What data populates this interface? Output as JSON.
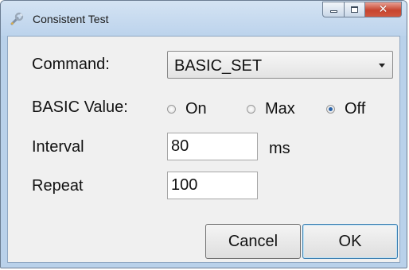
{
  "window": {
    "title": "Consistent Test",
    "icon": "wrench-icon",
    "caption_buttons": {
      "minimize_icon": "minimize-icon",
      "maximize_icon": "maximize-icon",
      "close_glyph": "✕"
    }
  },
  "form": {
    "command": {
      "label": "Command:",
      "value": "BASIC_SET"
    },
    "basic_value": {
      "label": "BASIC Value:",
      "options": [
        "On",
        "Max",
        "Off"
      ],
      "selected": "Off"
    },
    "interval": {
      "label": "Interval",
      "value": "80",
      "unit": "ms"
    },
    "repeat": {
      "label": "Repeat",
      "value": "100"
    }
  },
  "buttons": {
    "cancel": "Cancel",
    "ok": "OK"
  },
  "colors": {
    "title_bar": "#bcd3ec",
    "close_button": "#c7452f",
    "dialog_background": "#f0f0f0"
  }
}
